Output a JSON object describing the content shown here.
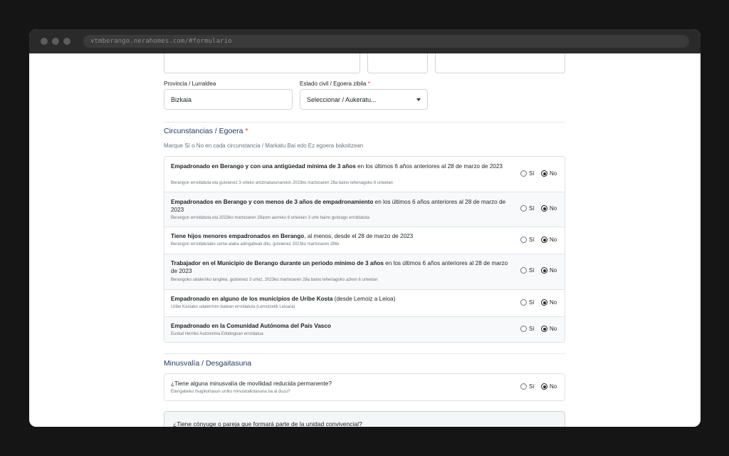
{
  "browser": {
    "url": "vtmberango.nerahomes.com/#formulario"
  },
  "form": {
    "province_label": "Provincia / Lurraldea",
    "province_value": "Bizkaia",
    "civil_label": "Estado civil / Egoera zibila",
    "civil_required": "*",
    "civil_value": "Seleccionar / Aukeratu..."
  },
  "circumstances": {
    "title": "Circunstancias / Egoera",
    "required": "*",
    "hint": "Marque Sí o No en cada circunstancia / Markatu Bai edo Ez egoera bakoitzean",
    "yes_label": "Sí",
    "no_label": "No",
    "items": [
      {
        "bold": "Empadronado en Berango y con una antigüedad mínima de 3 años",
        "rest": " en los últimos 6 años anteriores al 28 de marzo de 2023",
        "sub": "Berangon erroldatuta eta gutxienez 3 urteko antzinatasunarekin 2023ko martxoaren 28a baino lehenagoko 6 urteetan",
        "selected": "No"
      },
      {
        "bold": "Empadronados en Berango y con menos de 3 años de empadronamiento",
        "rest": " en los últimos 6 años anteriores al 28 de marzo de 2023",
        "sub": "Berangon erroldatuta eta 2023ko martxoaren 28aren aurreko 6 urteetan 3 urte baino gutxiago erroldatuta",
        "selected": "No"
      },
      {
        "bold": "Tiene hijos menores empadronados en Berango",
        "rest": ", al menos, desde el 28 de marzo de 2023",
        "sub": "Berangon erroldatutako seme-alaba adingabeak ditu, gutxienez 2023ko martxoaren 28tik",
        "selected": "No"
      },
      {
        "bold": "Trabajador en el Municipio de Berango durante un periodo mínimo de 3 años",
        "rest": " en los últimos 6 años anteriores al 28 de marzo de 2023",
        "sub": "Berangoko udalerriko langilea, gutxienez 3 urtez, 2023ko martxoaren 28a baino lehenagoko azken 6 urteetan",
        "selected": "No"
      },
      {
        "bold": "Empadronado en alguno de los municipios de Uribe Kosta",
        "rest": " (desde Lemoiz a Leioa)",
        "sub": "Uribe Kostako udalerriren batean erroldatuta (Lemoizetik Leioara)",
        "selected": "No"
      },
      {
        "bold": "Empadronado en la Comunidad Autónoma del País Vasco",
        "rest": "",
        "sub": "Euskal Herriko Autonomia Erkidegoan erroldatua",
        "selected": "No"
      }
    ]
  },
  "disability": {
    "title": "Minusvalía / Desgaitasuna",
    "question": "¿Tiene alguna minusvalía de movilidad reducida permanente?",
    "sub": "Etengabeko mugikortasun urriko minusbaliotasuna ba al duzu?",
    "yes_label": "Sí",
    "no_label": "No",
    "selected": "No"
  },
  "spouse": {
    "question": "¿Tiene cónyuge o pareja que formará parte de la unidad convivencial?"
  }
}
